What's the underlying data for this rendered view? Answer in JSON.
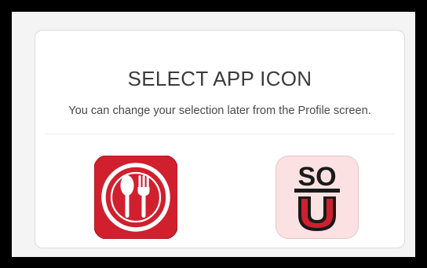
{
  "dialog": {
    "title": "SELECT APP ICON",
    "subtitle": "You can change your selection later from the Profile screen."
  },
  "icons": [
    {
      "name": "restaurant-icon",
      "description": "spoon and fork",
      "background": "#d0202e"
    },
    {
      "name": "sou-icon",
      "text_top": "SO",
      "text_bottom": "U",
      "background": "#fbe1e2",
      "accent": "#d0202e"
    }
  ],
  "colors": {
    "frame": "#000000",
    "screen_bg": "#f4f4f4",
    "card_bg": "#ffffff",
    "brand_red": "#d0202e",
    "text": "#3b3b3b"
  }
}
